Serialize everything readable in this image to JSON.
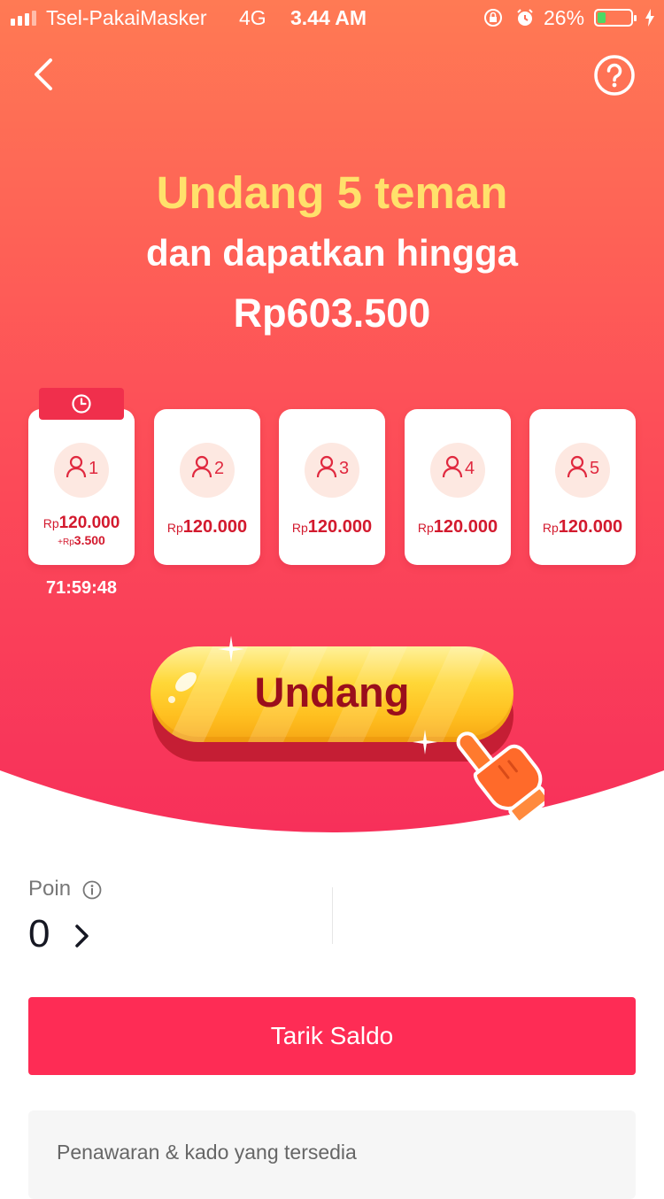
{
  "status_bar": {
    "carrier": "Tsel-PakaiMasker",
    "network": "4G",
    "time": "3.44 AM",
    "battery_percent": "26%",
    "battery_level": 0.26
  },
  "header": {
    "back_icon": "chevron-left-icon",
    "help_icon": "question-circle-icon"
  },
  "headline": {
    "line1": "Undang 5 teman",
    "line2": "dan dapatkan hingga",
    "line3": "Rp603.500"
  },
  "rewards": [
    {
      "step": "1",
      "currency": "Rp",
      "amount": "120.000",
      "bonus_prefix": "+Rp",
      "bonus": "3.500"
    },
    {
      "step": "2",
      "currency": "Rp",
      "amount": "120.000"
    },
    {
      "step": "3",
      "currency": "Rp",
      "amount": "120.000"
    },
    {
      "step": "4",
      "currency": "Rp",
      "amount": "120.000"
    },
    {
      "step": "5",
      "currency": "Rp",
      "amount": "120.000"
    }
  ],
  "countdown": "71:59:48",
  "invite_button": "Undang",
  "points": {
    "label": "Poin",
    "value": "0"
  },
  "withdraw_button": "Tarik Saldo",
  "offers_title": "Penawaran & kado yang tersedia",
  "colors": {
    "accent": "#fe2c55",
    "headline_yellow": "#ffe16b",
    "reward_red": "#d31a2e"
  }
}
